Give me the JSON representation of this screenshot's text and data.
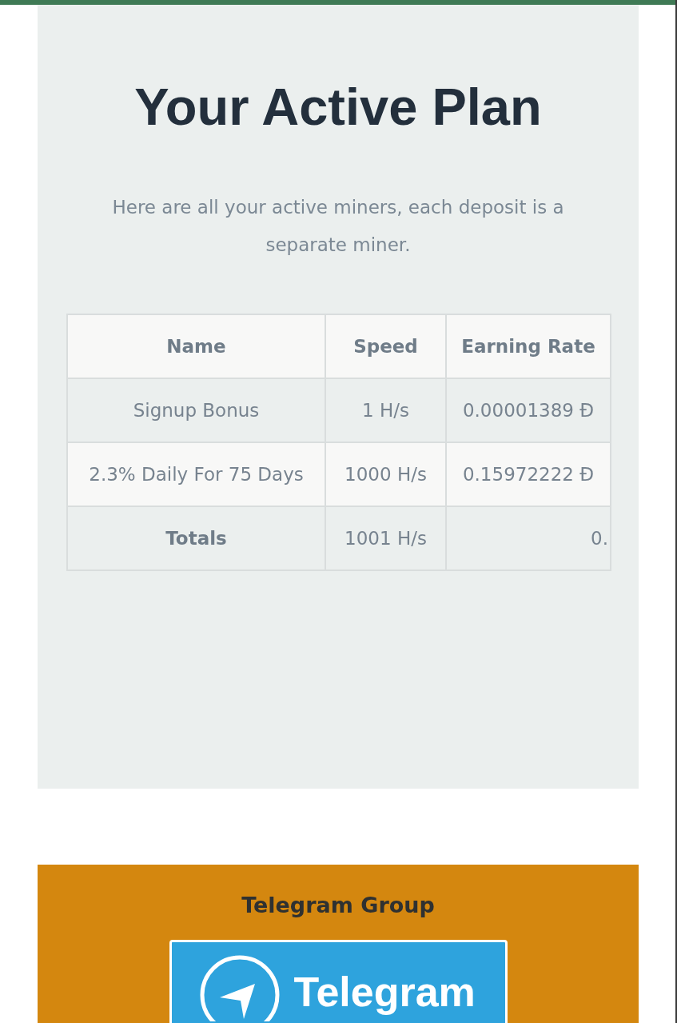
{
  "plan": {
    "title": "Your Active Plan",
    "subtitle": "Here are all your active miners, each deposit is a separate miner.",
    "table": {
      "columns": [
        "Name",
        "Speed",
        "Earning Rate"
      ],
      "rows": [
        {
          "name": "Signup Bonus",
          "speed": "1 H/s",
          "earning_rate": "0.00001389 Đ"
        },
        {
          "name": "2.3% Daily For 75 Days",
          "speed": "1000 H/s",
          "earning_rate": "0.15972222 Đ"
        }
      ],
      "totals": {
        "label": "Totals",
        "speed": "1001 H/s",
        "earning_rate": "0."
      }
    }
  },
  "telegram": {
    "heading": "Telegram Group",
    "banner_label": "Telegram"
  }
}
